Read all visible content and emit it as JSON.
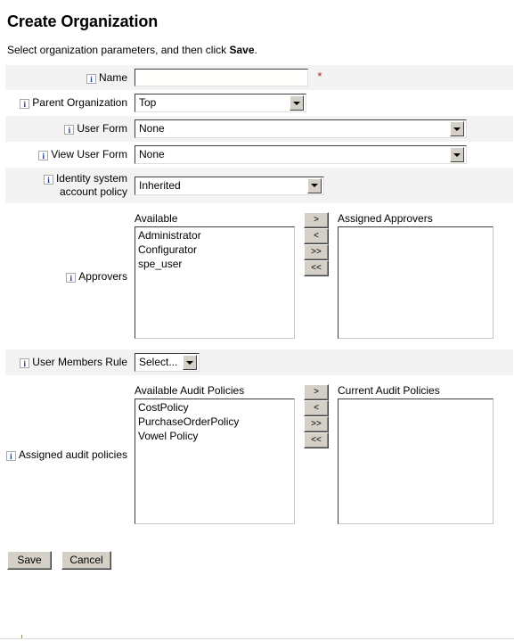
{
  "header": {
    "title": "Create Organization",
    "subtitle_before": "Select organization parameters, and then click ",
    "subtitle_bold": "Save",
    "subtitle_after": "."
  },
  "icons": {
    "info": "i",
    "required": "*"
  },
  "fields": {
    "name": {
      "label": "Name",
      "value": "",
      "placeholder": "",
      "required_marker": "*"
    },
    "parent_organization": {
      "label": "Parent Organization",
      "selected": "Top"
    },
    "user_form": {
      "label": "User Form",
      "selected": "None"
    },
    "view_user_form": {
      "label": "View User Form",
      "selected": "None"
    },
    "identity_system_account_policy": {
      "label": "Identity system account policy",
      "selected": "Inherited"
    },
    "user_members_rule": {
      "label": "User Members Rule",
      "selected": "Select..."
    }
  },
  "approvers": {
    "label": "Approvers",
    "available_header": "Available",
    "assigned_header": "Assigned Approvers",
    "available": [
      "Administrator",
      "Configurator",
      "spe_user"
    ],
    "assigned": [],
    "buttons": [
      ">",
      "<",
      ">>",
      "<<"
    ]
  },
  "audit_policies": {
    "label": "Assigned audit policies",
    "available_header": "Available Audit Policies",
    "current_header": "Current Audit Policies",
    "available": [
      "CostPolicy",
      "PurchaseOrderPolicy",
      "Vowel Policy"
    ],
    "current": [],
    "buttons": [
      ">",
      "<",
      ">>",
      "<<"
    ]
  },
  "footer": {
    "save_label": "Save",
    "cancel_label": "Cancel"
  },
  "colors": {
    "alt_row": "#f3f3f3",
    "button_face": "#d4d0c8",
    "required_star": "#b02020",
    "info_glyph": "#15338e"
  }
}
